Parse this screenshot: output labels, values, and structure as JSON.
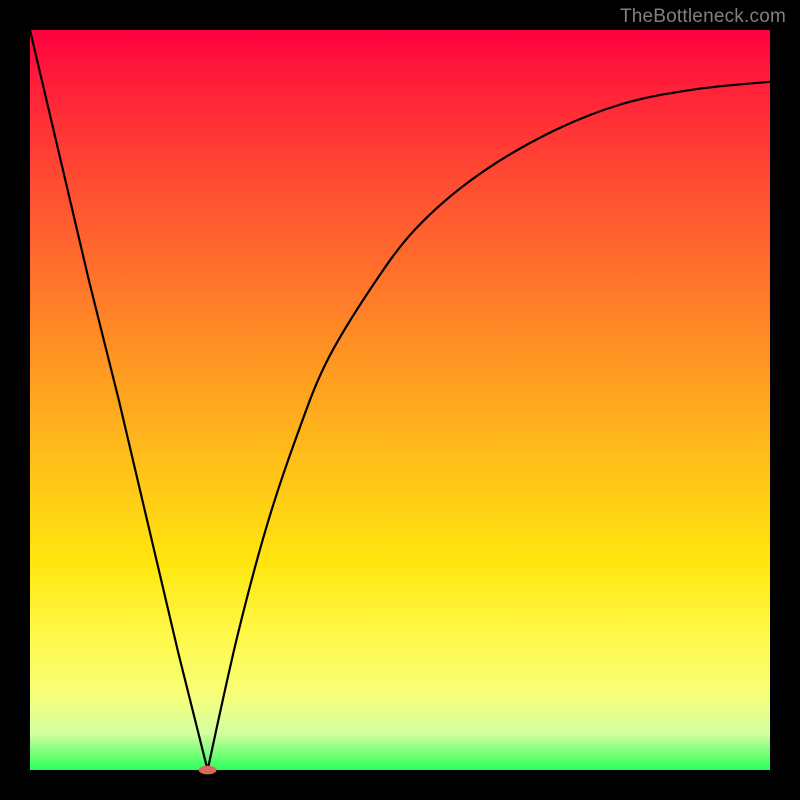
{
  "watermark": "TheBottleneck.com",
  "chart_data": {
    "type": "line",
    "title": "",
    "xlabel": "",
    "ylabel": "",
    "xlim": [
      0,
      1
    ],
    "ylim": [
      0,
      1
    ],
    "grid": false,
    "legend": false,
    "min_at_x": 0.24,
    "series": [
      {
        "name": "left",
        "x": [
          0.0,
          0.04,
          0.08,
          0.12,
          0.16,
          0.2,
          0.24
        ],
        "y": [
          1.0,
          0.83,
          0.66,
          0.5,
          0.33,
          0.16,
          0.0
        ]
      },
      {
        "name": "right",
        "x": [
          0.24,
          0.28,
          0.32,
          0.36,
          0.4,
          0.46,
          0.52,
          0.6,
          0.7,
          0.8,
          0.9,
          1.0
        ],
        "y": [
          0.0,
          0.18,
          0.33,
          0.45,
          0.55,
          0.65,
          0.73,
          0.8,
          0.86,
          0.9,
          0.92,
          0.93
        ]
      }
    ],
    "marker": {
      "x": 0.24,
      "y": 0.0,
      "rx": 0.012,
      "ry": 0.006
    }
  },
  "colors": {
    "curve": "#000000",
    "marker": "#d86a5c"
  }
}
